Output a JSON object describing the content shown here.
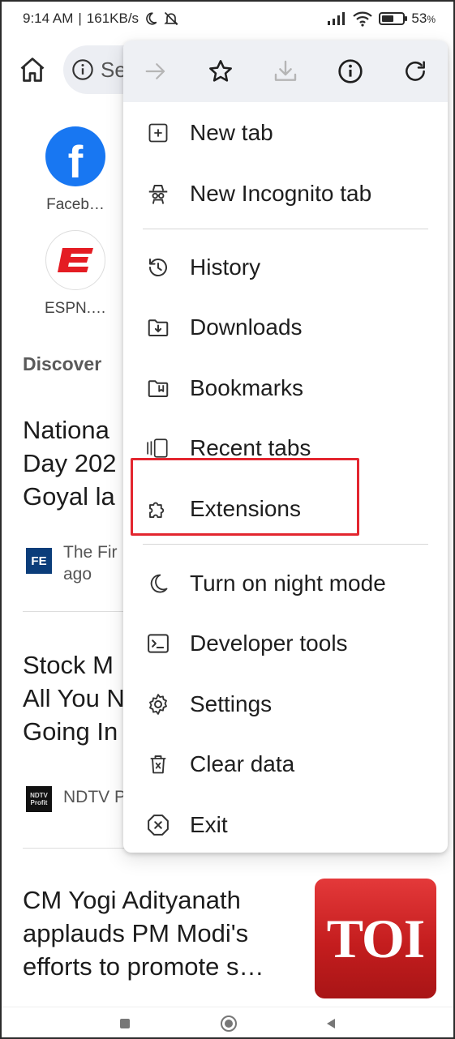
{
  "status_bar": {
    "time": "9:14 AM",
    "network_speed": "161KB/s",
    "battery_percent": "53",
    "battery_symbol": "%"
  },
  "browser": {
    "omnibox_text": "Se"
  },
  "shortcuts": [
    {
      "label": "Faceb…",
      "icon": "facebook-logo"
    },
    {
      "label": "ESPN.…",
      "icon": "espn-logo"
    }
  ],
  "discover": {
    "heading": "Discover",
    "articles": [
      {
        "title": "Nationa\nDay 202\nGoyal la",
        "source": "The Fir\nago",
        "source_logo": "FE"
      },
      {
        "title": "Stock M\nAll You N\nGoing In",
        "source": "NDTV P",
        "source_logo": "NDTV Profit"
      },
      {
        "title": "CM Yogi Adityanath\napplauds PM Modi's\nefforts to promote s…",
        "thumbnail_text": "TOI"
      }
    ]
  },
  "menu": {
    "toolbar": {
      "forward": "forward-arrow-icon",
      "bookmark": "star-icon",
      "download": "download-icon",
      "info": "info-icon",
      "refresh": "refresh-icon"
    },
    "items": [
      {
        "label": "New tab",
        "icon": "plus-square-icon"
      },
      {
        "label": "New Incognito tab",
        "icon": "incognito-icon"
      },
      {
        "label": "History",
        "icon": "history-icon"
      },
      {
        "label": "Downloads",
        "icon": "download-folder-icon"
      },
      {
        "label": "Bookmarks",
        "icon": "bookmarks-folder-icon"
      },
      {
        "label": "Recent tabs",
        "icon": "recent-tabs-icon"
      },
      {
        "label": "Extensions",
        "icon": "puzzle-icon"
      },
      {
        "label": "Turn on night mode",
        "icon": "moon-icon"
      },
      {
        "label": "Developer tools",
        "icon": "terminal-icon"
      },
      {
        "label": "Settings",
        "icon": "gear-icon"
      },
      {
        "label": "Clear data",
        "icon": "trash-icon"
      },
      {
        "label": "Exit",
        "icon": "close-circle-icon"
      }
    ],
    "highlighted_item": "Extensions"
  },
  "colors": {
    "highlight": "#e3262f",
    "facebook": "#1877f2",
    "espn": "#e41c23",
    "toi": "#c41d1e"
  }
}
